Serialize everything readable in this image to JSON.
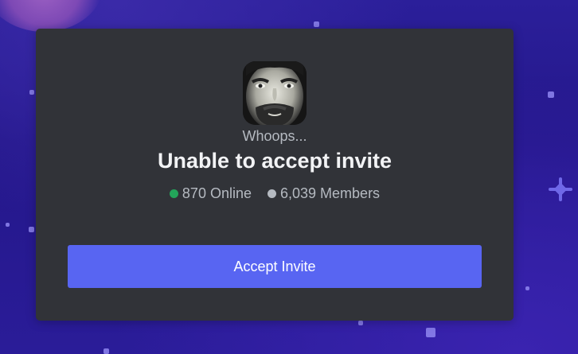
{
  "invite": {
    "subtitle": "Whoops...",
    "title": "Unable to accept invite",
    "online_count": "870 Online",
    "member_count": "6,039 Members",
    "accept_label": "Accept Invite"
  },
  "colors": {
    "online_dot": "#23a55a",
    "members_dot": "#b5bac1",
    "accent": "#5865f2",
    "card_background": "#313338"
  },
  "icons": {
    "server": "server-avatar-icon"
  }
}
